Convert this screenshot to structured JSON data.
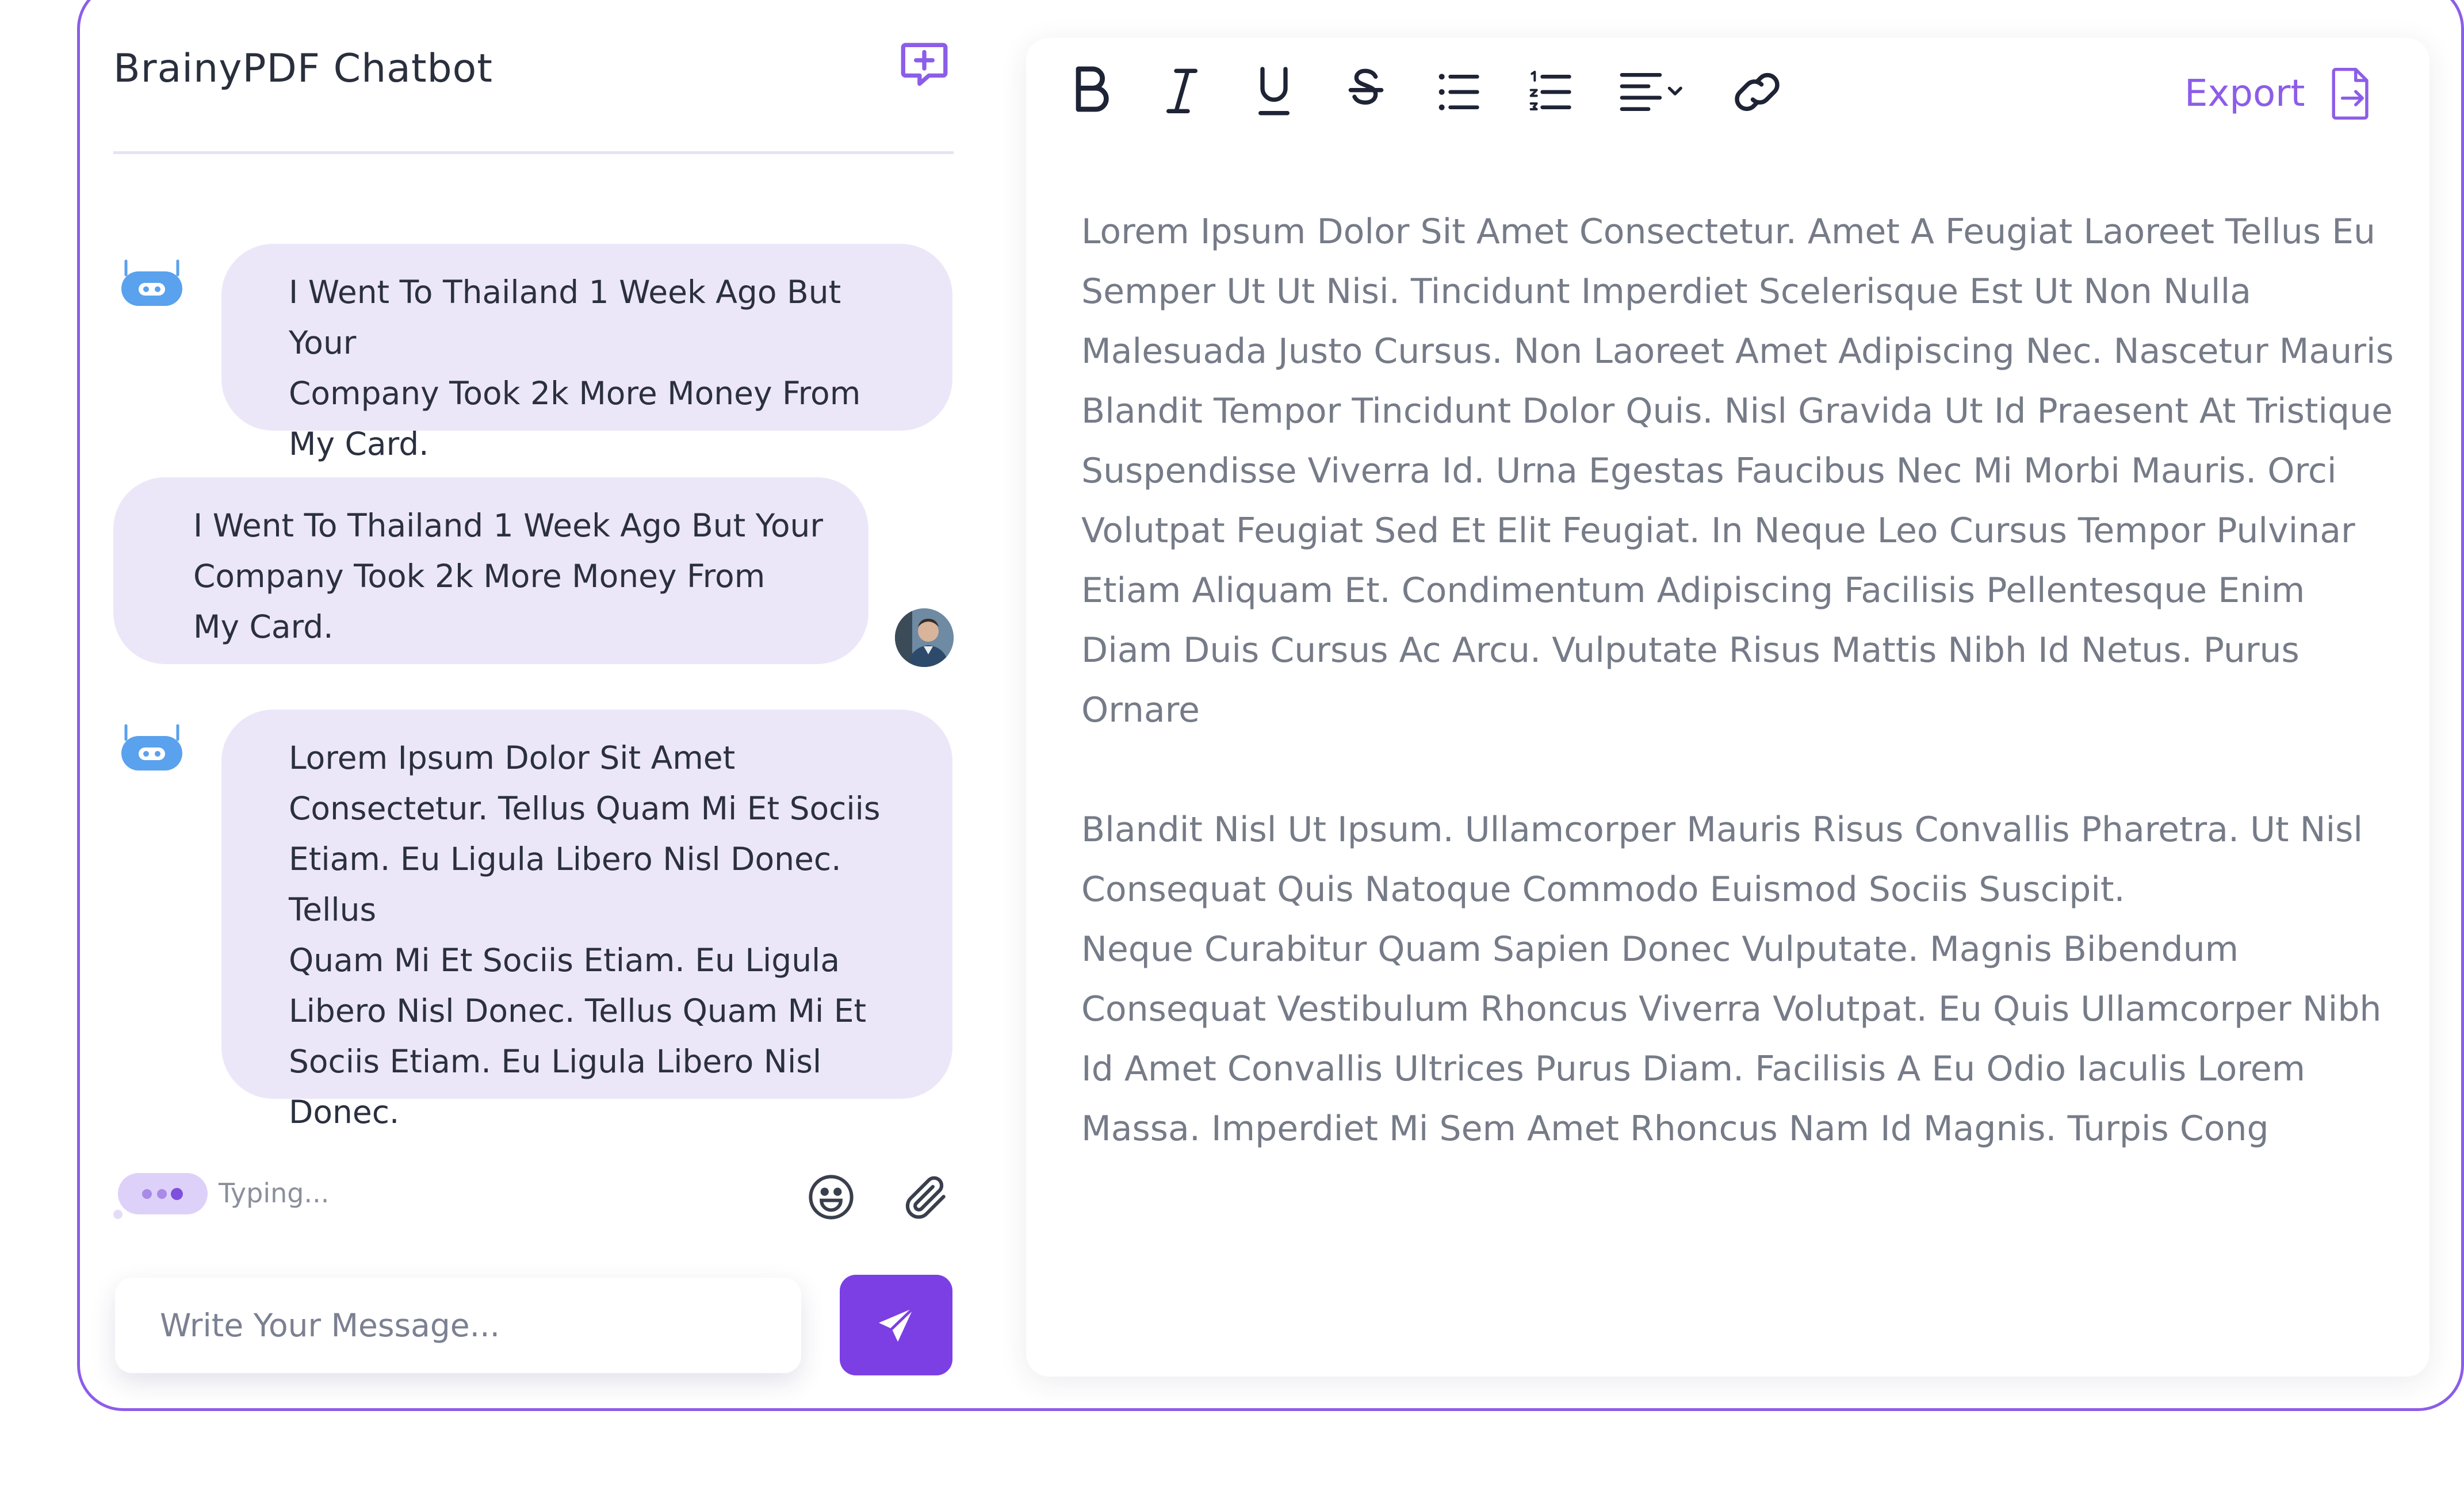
{
  "chat": {
    "title": "BrainyPDF Chatbot",
    "messages": [
      {
        "sender": "bot",
        "text": "I Went To Thailand 1 Week Ago But Your\nCompany Took 2k More Money From\nMy Card."
      },
      {
        "sender": "user",
        "text": "I Went To Thailand 1 Week Ago But Your\nCompany Took 2k More Money From\nMy Card."
      },
      {
        "sender": "bot",
        "text": "Lorem Ipsum Dolor Sit Amet\nConsectetur. Tellus Quam Mi Et Sociis\nEtiam. Eu Ligula Libero Nisl Donec. Tellus\nQuam Mi Et Sociis Etiam. Eu Ligula\nLibero Nisl Donec. Tellus Quam Mi Et\nSociis Etiam. Eu Ligula Libero Nisl\nDonec."
      }
    ],
    "typing_label": "Typing...",
    "input_placeholder": "Write Your Message...",
    "icons": {
      "new_chat": "message-plus-icon",
      "bot": "robot-icon",
      "emoji": "smiley-icon",
      "attach": "paperclip-icon",
      "send": "paper-plane-icon"
    }
  },
  "editor": {
    "toolbar": [
      "bold-icon",
      "italic-icon",
      "underline-icon",
      "strikethrough-icon",
      "bullet-list-icon",
      "numbered-list-icon",
      "align-dropdown-icon",
      "link-icon"
    ],
    "export_label": "Export",
    "paragraphs": [
      "Lorem Ipsum Dolor Sit Amet Consectetur. Amet A Feugiat Laoreet Tellus Eu Semper Ut Ut Nisi. Tincidunt Imperdiet Scelerisque Est Ut Non Nulla Malesuada Justo Cursus. Non Laoreet Amet Adipiscing Nec. Nascetur Mauris Blandit Tempor Tincidunt Dolor Quis. Nisl Gravida Ut Id Praesent At Tristique Suspendisse Viverra Id. Urna Egestas Faucibus Nec Mi Morbi Mauris. Orci Volutpat Feugiat Sed Et Elit Feugiat. In Neque Leo Cursus Tempor Pulvinar Etiam Aliquam Et. Condimentum Adipiscing Facilisis Pellentesque Enim Diam Duis Cursus Ac Arcu. Vulputate Risus Mattis Nibh Id Netus. Purus Ornare",
      "Blandit Nisl Ut Ipsum. Ullamcorper Mauris Risus Convallis Pharetra. Ut Nisl Consequat Quis Natoque Commodo Euismod Sociis Suscipit.",
      "Neque Curabitur Quam Sapien Donec Vulputate. Magnis Bibendum Consequat Vestibulum Rhoncus Viverra Volutpat. Eu Quis Ullamcorper Nibh Id Amet Convallis Ultrices Purus Diam. Facilisis A Eu Odio Iaculis Lorem Massa. Imperdiet Mi Sem Amet Rhoncus Nam Id Magnis. Turpis Cong"
    ]
  },
  "colors": {
    "accent": "#7b3fe4",
    "frame_border": "#8c5de8",
    "bubble": "#ece7f8",
    "bot_icon": "#5aa1ee"
  }
}
